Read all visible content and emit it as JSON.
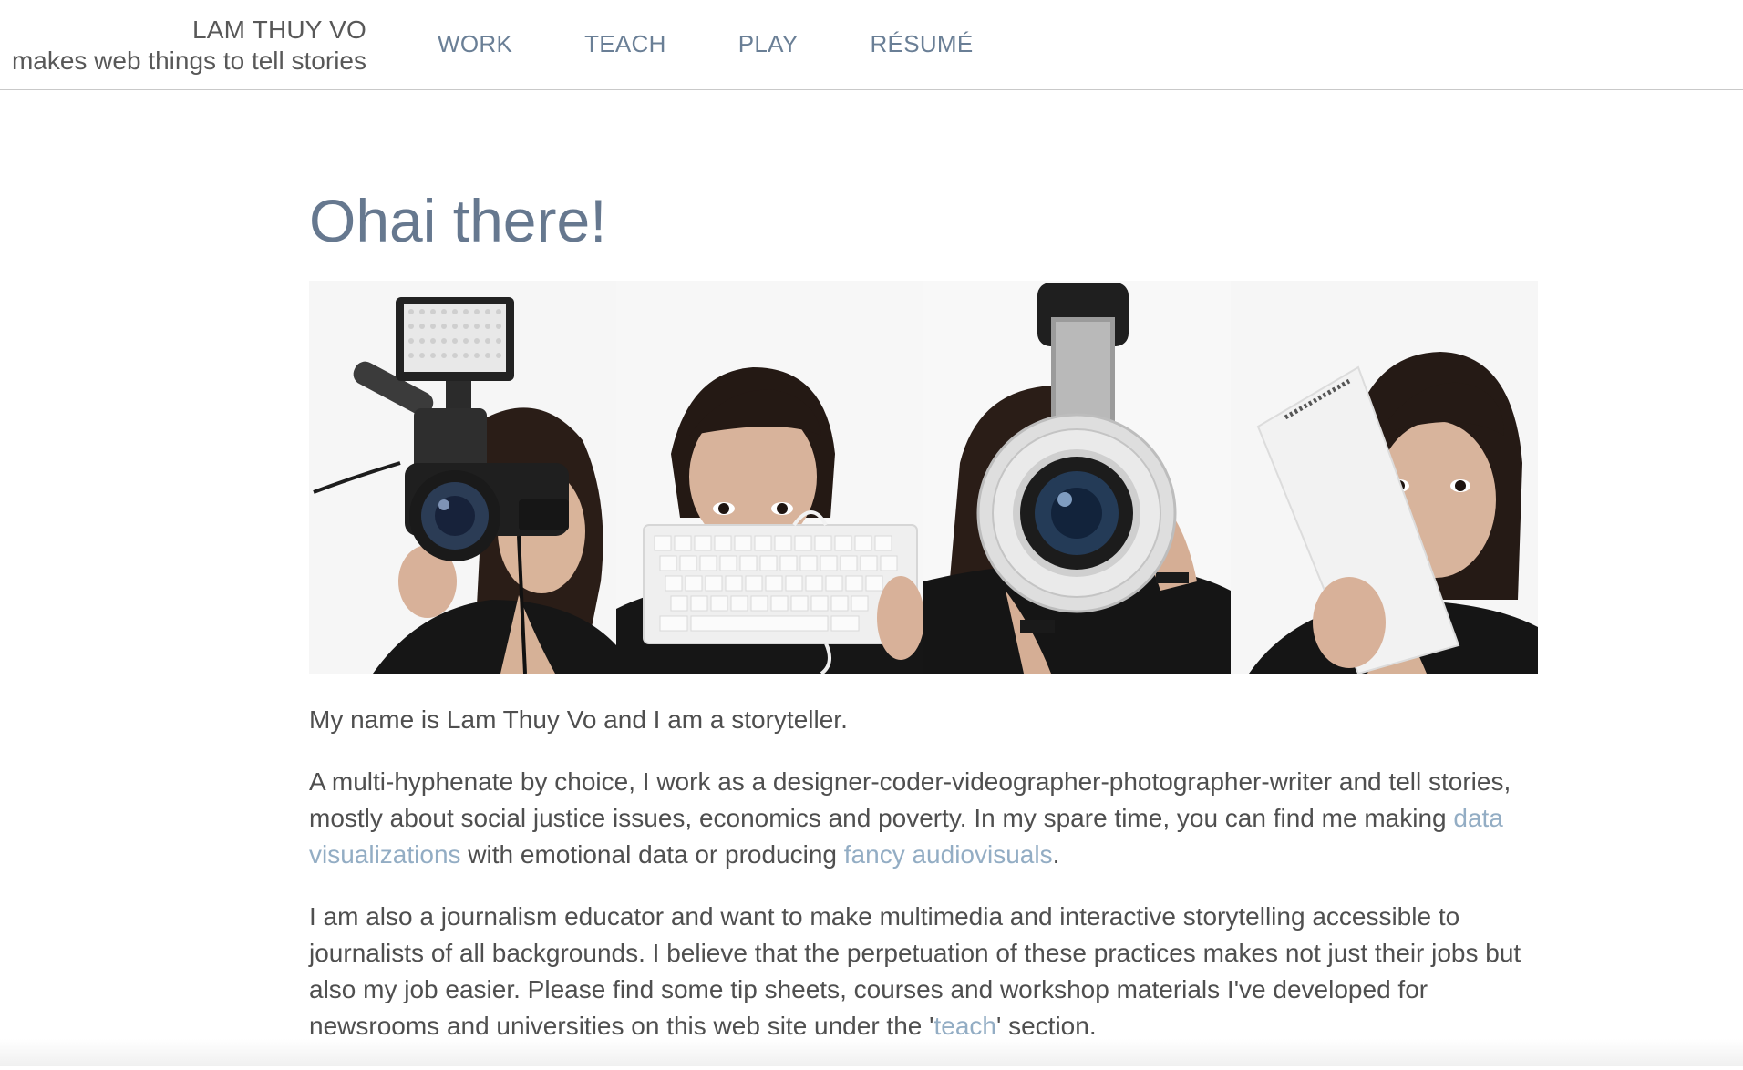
{
  "header": {
    "name": "LAM THUY VO",
    "tagline": "makes web things to tell stories",
    "nav": [
      {
        "label": "WORK"
      },
      {
        "label": "TEACH"
      },
      {
        "label": "PLAY"
      },
      {
        "label": "RÉSUMÉ"
      }
    ]
  },
  "main": {
    "heading": "Ohai there!",
    "photos": [
      {
        "subject": "camcorder-with-light-photo"
      },
      {
        "subject": "keyboard-photo"
      },
      {
        "subject": "camera-lens-photo"
      },
      {
        "subject": "notepad-photo"
      }
    ],
    "intro": "My name is Lam Thuy Vo and I am a storyteller.",
    "p2": {
      "text1": "A multi-hyphenate by choice, I work as a designer-coder-videographer-photographer-writer and tell stories, mostly about social justice issues, economics and poverty. In my spare time, you can find me making ",
      "link1": "data visualizations",
      "text2": " with emotional data or producing ",
      "link2": "fancy audiovisuals",
      "text3": "."
    },
    "p3": {
      "text1": "I am also a journalism educator and want to make multimedia and interactive storytelling accessible to journalists of all backgrounds. I believe that the perpetuation of these practices makes not just their jobs but also my job easier. Please find some tip sheets, courses and workshop materials I've developed for newsrooms and universities on this web site under the '",
      "link": "teach",
      "text2": "' section."
    }
  },
  "colors": {
    "nav": "#6a7f96",
    "heading": "#66788f",
    "link": "#93adc4",
    "body_text": "#4f4f4f"
  }
}
